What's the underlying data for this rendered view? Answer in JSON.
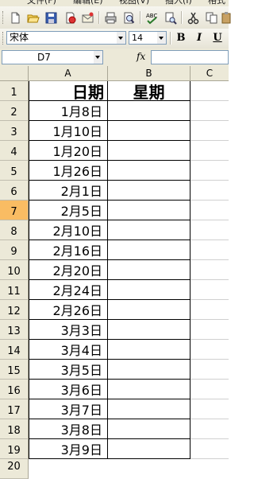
{
  "menu": {
    "items": [
      "文件(F)",
      "编辑(E)",
      "视图(V)",
      "插入(I)",
      "格式"
    ]
  },
  "toolbar": {
    "font_name": "宋体",
    "font_size": "14",
    "bold_label": "B",
    "italic_label": "I",
    "underline_label": "U"
  },
  "formula_bar": {
    "name_box": "D7",
    "fx_label": "fx",
    "formula": ""
  },
  "sheet": {
    "columns": [
      "A",
      "B",
      "C"
    ],
    "header_row": {
      "row": "1",
      "a": "日期",
      "b": "星期"
    },
    "rows": [
      {
        "row": "2",
        "a": "1月8日"
      },
      {
        "row": "3",
        "a": "1月10日"
      },
      {
        "row": "4",
        "a": "1月20日"
      },
      {
        "row": "5",
        "a": "1月26日"
      },
      {
        "row": "6",
        "a": "2月1日"
      },
      {
        "row": "7",
        "a": "2月5日"
      },
      {
        "row": "8",
        "a": "2月10日"
      },
      {
        "row": "9",
        "a": "2月16日"
      },
      {
        "row": "10",
        "a": "2月20日"
      },
      {
        "row": "11",
        "a": "2月24日"
      },
      {
        "row": "12",
        "a": "2月26日"
      },
      {
        "row": "13",
        "a": "3月3日"
      },
      {
        "row": "14",
        "a": "3月4日"
      },
      {
        "row": "15",
        "a": "3月5日"
      },
      {
        "row": "16",
        "a": "3月6日"
      },
      {
        "row": "17",
        "a": "3月7日"
      },
      {
        "row": "18",
        "a": "3月8日"
      },
      {
        "row": "19",
        "a": "3月9日"
      }
    ],
    "partial_row": "20",
    "active_row": "7",
    "active_row_color": "#f9bc63",
    "header_color": "#ece9d8"
  }
}
